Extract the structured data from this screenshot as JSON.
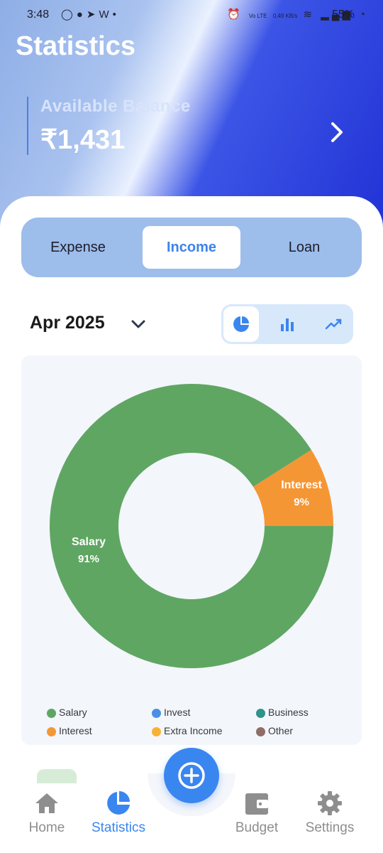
{
  "status_bar": {
    "time": "3:48",
    "left_icons": [
      "whatsapp-icon",
      "chat-icon",
      "telegram-icon",
      "wifi-call-icon",
      "dot-icon"
    ],
    "right_icons": [
      "alarm-icon",
      "volte-icon",
      "data-speed-icon",
      "wifi-icon",
      "signal-icon",
      "battery-icon"
    ],
    "network_text": "Vo LTE",
    "speed_text": "0.49 KB/s",
    "battery": "55%"
  },
  "header": {
    "title": "Statistics",
    "balance_label": "Available Balance",
    "balance_value": "₹1,431"
  },
  "tabs": [
    {
      "label": "Expense",
      "active": false
    },
    {
      "label": "Income",
      "active": true
    },
    {
      "label": "Loan",
      "active": false
    }
  ],
  "period": {
    "label": "Apr 2025"
  },
  "chart_types": [
    {
      "icon": "pie-chart-icon",
      "active": true
    },
    {
      "icon": "bar-chart-icon",
      "active": false
    },
    {
      "icon": "line-chart-icon",
      "active": false
    }
  ],
  "chart_data": {
    "type": "pie",
    "categories": [
      "Salary",
      "Interest"
    ],
    "values": [
      91,
      9
    ],
    "labels": [
      "91%",
      "9%"
    ],
    "colors": [
      "#5fa663",
      "#f59635"
    ],
    "legend": [
      {
        "name": "Salary",
        "color": "#5fa663"
      },
      {
        "name": "Invest",
        "color": "#4a8fe4"
      },
      {
        "name": "Business",
        "color": "#2f938a"
      },
      {
        "name": "Interest",
        "color": "#f59635"
      },
      {
        "name": "Extra Income",
        "color": "#f7b236"
      },
      {
        "name": "Other",
        "color": "#8f6e66"
      }
    ],
    "legend_position": "bottom"
  },
  "bottom_nav": [
    {
      "label": "Home",
      "icon": "home-icon",
      "active": false
    },
    {
      "label": "Statistics",
      "icon": "pie-chart-icon",
      "active": true
    },
    {
      "label": "Budget",
      "icon": "wallet-icon",
      "active": false
    },
    {
      "label": "Settings",
      "icon": "gear-icon",
      "active": false
    }
  ],
  "fab": {
    "icon": "plus-icon"
  },
  "colors": {
    "accent": "#3a86f0",
    "tab_bar_bg": "#9dbdeb",
    "card_bg": "#f3f6fb",
    "header_blue": "#2233d6"
  }
}
